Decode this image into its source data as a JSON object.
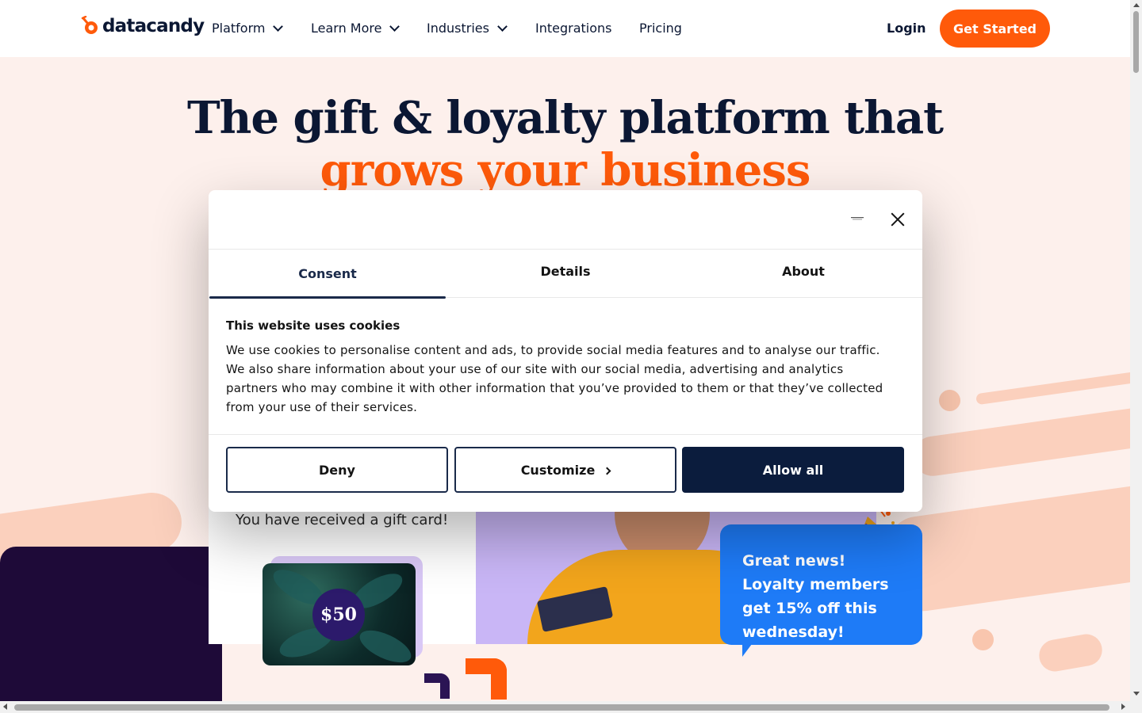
{
  "nav": {
    "brand": "datacandy",
    "items": [
      {
        "label": "Platform",
        "has_dropdown": true
      },
      {
        "label": "Learn More",
        "has_dropdown": true
      },
      {
        "label": "Industries",
        "has_dropdown": true
      },
      {
        "label": "Integrations",
        "has_dropdown": false
      },
      {
        "label": "Pricing",
        "has_dropdown": false
      }
    ],
    "login": "Login",
    "cta": "Get Started"
  },
  "hero": {
    "title_line1": "The gift & loyalty platform that",
    "title_line2": "grows your business"
  },
  "promo": {
    "gift_text": "You have received a gift card!",
    "gift_amount": "$50",
    "bubble_text": "Great news! Loyalty members get 15% off this wednesday!"
  },
  "modal": {
    "tabs": [
      {
        "label": "Consent",
        "active": true
      },
      {
        "label": "Details",
        "active": false
      },
      {
        "label": "About",
        "active": false
      }
    ],
    "title": "This website uses cookies",
    "body": "We use cookies to personalise content and ads, to provide social media features and to analyse our traffic. We also share information about your use of our site with our social media, advertising and analytics partners who may combine it with other information that you’ve provided to them or that they’ve collected from your use of their services.",
    "buttons": {
      "deny": "Deny",
      "customize": "Customize",
      "allow": "Allow all"
    }
  },
  "colors": {
    "brand_orange": "#ff5a0a",
    "navy": "#0b1c3d",
    "hero_bg": "#fdf0ec",
    "bubble_blue": "#1e7bf7"
  },
  "icons": [
    "candy-logo-icon",
    "chevron-down-icon",
    "close-icon",
    "chevron-right-icon",
    "party-popper-icon"
  ]
}
